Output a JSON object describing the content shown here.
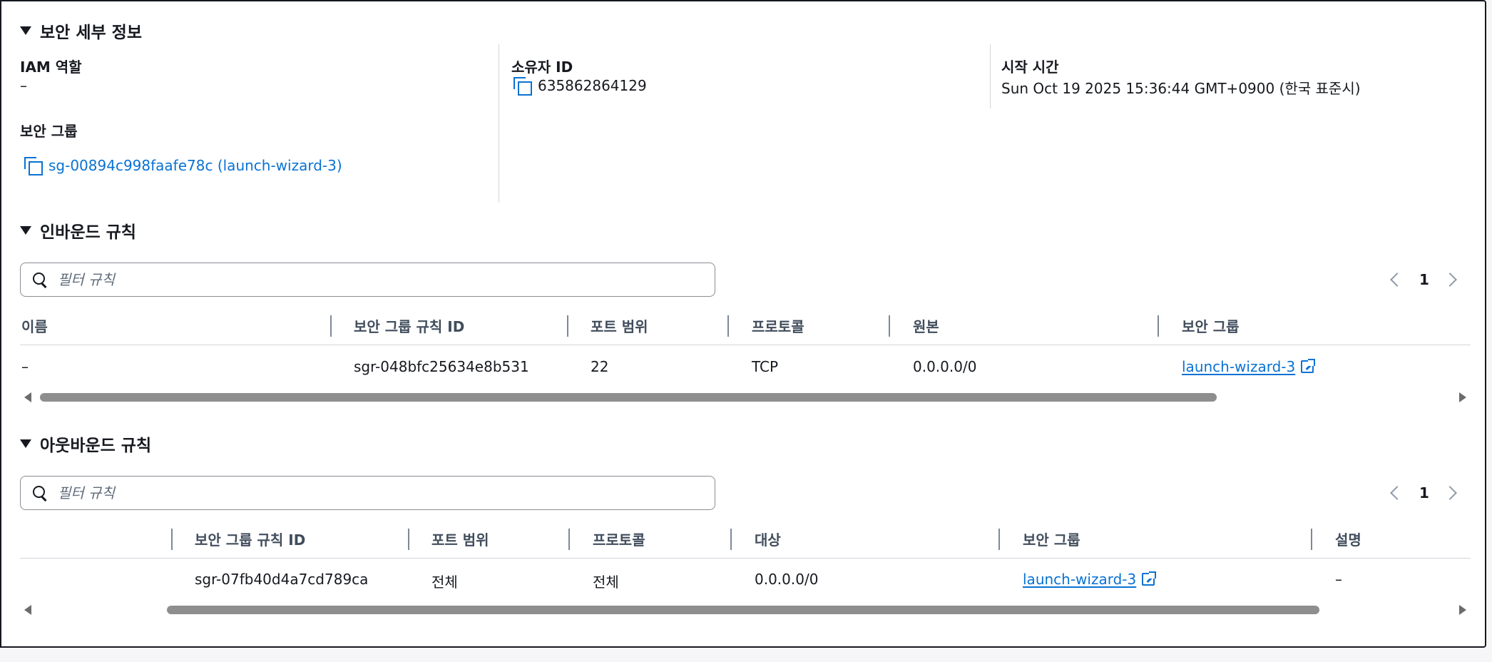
{
  "security_details": {
    "title": "보안 세부 정보",
    "iam_role_label": "IAM 역할",
    "iam_role_value": "–",
    "owner_id_label": "소유자 ID",
    "owner_id_value": "635862864129",
    "launch_time_label": "시작 시간",
    "launch_time_value": "Sun Oct 19 2025 15:36:44 GMT+0900 (한국 표준시)",
    "security_groups_label": "보안 그룹",
    "security_group_link": "sg-00894c998faafe78c (launch-wizard-3)"
  },
  "inbound": {
    "title": "인바운드 규칙",
    "filter_placeholder": "필터 규칙",
    "page": "1",
    "columns": [
      "이름",
      "보안 그룹 규칙 ID",
      "포트 범위",
      "프로토콜",
      "원본",
      "보안 그룹"
    ],
    "rows": [
      {
        "name": "–",
        "rule_id": "sgr-048bfc25634e8b531",
        "port": "22",
        "protocol": "TCP",
        "source": "0.0.0.0/0",
        "sg": "launch-wizard-3"
      }
    ]
  },
  "outbound": {
    "title": "아웃바운드 규칙",
    "filter_placeholder": "필터 규칙",
    "page": "1",
    "columns": [
      "보안 그룹 규칙 ID",
      "포트 범위",
      "프로토콜",
      "대상",
      "보안 그룹",
      "설명"
    ],
    "rows": [
      {
        "rule_id": "sgr-07fb40d4a7cd789ca",
        "port": "전체",
        "protocol": "전체",
        "dest": "0.0.0.0/0",
        "sg": "launch-wizard-3",
        "desc": "–"
      }
    ]
  },
  "colors": {
    "link": "#0972d3",
    "text": "#16191f",
    "header_text": "#414d5c"
  }
}
